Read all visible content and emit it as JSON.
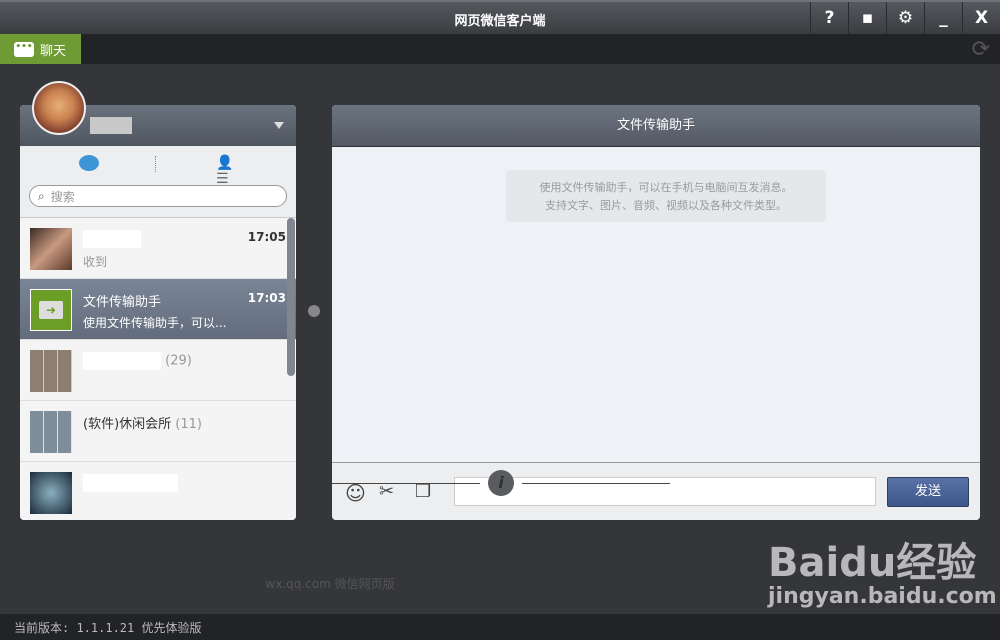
{
  "window": {
    "title": "网页微信客户端",
    "buttons": [
      "?",
      "▪",
      "⚙",
      "_",
      "X"
    ]
  },
  "tabs": {
    "chat": "聊天"
  },
  "sidebar": {
    "search_placeholder": "搜索",
    "conversations": [
      {
        "name": "",
        "time": "17:05",
        "message": "收到",
        "count": ""
      },
      {
        "name": "文件传输助手",
        "time": "17:03",
        "message": "使用文件传输助手，可以...",
        "count": ""
      },
      {
        "name": "",
        "time": "",
        "message": "",
        "count": "(29)"
      },
      {
        "name": "(软件)休闲会所",
        "time": "",
        "message": "",
        "count": "(11)"
      },
      {
        "name": "",
        "time": "",
        "message": "",
        "count": ""
      }
    ]
  },
  "chat": {
    "title": "文件传输助手",
    "notice_line1": "使用文件传输助手，可以在手机与电脑间互发消息。",
    "notice_line2": "支持文字、图片、音频、视频以及各种文件类型。",
    "send_label": "发送",
    "input_value": ""
  },
  "footer": {
    "text": "wx.qq.com  微信网页版"
  },
  "status": {
    "version": "当前版本: 1.1.1.21 优先体验版"
  },
  "watermark": {
    "line1": "Baidu经验",
    "line2": "jingyan.baidu.com"
  },
  "colors": {
    "accent_green": "#6f9b35",
    "send_blue": "#4a629a"
  }
}
